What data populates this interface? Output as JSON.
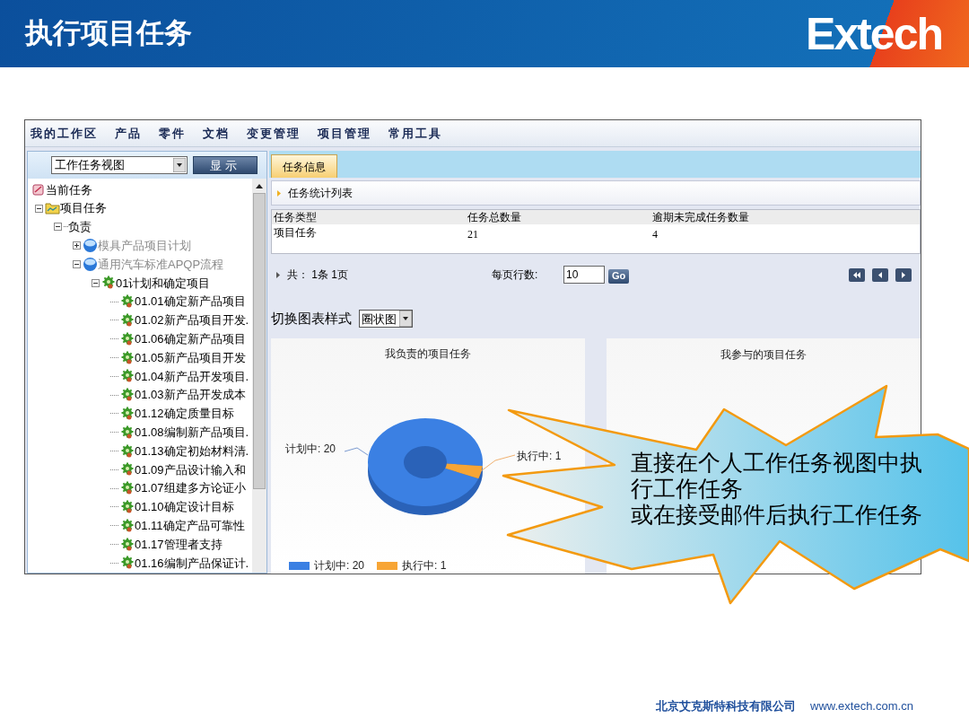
{
  "slide": {
    "title": "执行项目任务",
    "logo": "Extech"
  },
  "menu": [
    {
      "label": "我的工作区"
    },
    {
      "label": "产品"
    },
    {
      "label": "零件"
    },
    {
      "label": "文档"
    },
    {
      "label": "变更管理"
    },
    {
      "label": "项目管理"
    },
    {
      "label": "常用工具"
    }
  ],
  "view_select": {
    "value": "工作任务视图"
  },
  "show_button": "显示",
  "tree": [
    {
      "label": "当前任务",
      "kind": "root",
      "children": [
        {
          "label": "项目任务",
          "kind": "folder",
          "expanded": true,
          "children": [
            {
              "label": "负责",
              "kind": "group",
              "expanded": true,
              "children": [
                {
                  "label": "模具产品项目计划",
                  "kind": "project",
                  "expanded": false
                },
                {
                  "label": "通用汽车标准APQP流程",
                  "kind": "project",
                  "expanded": true,
                  "children": [
                    {
                      "label": "01计划和确定项目",
                      "kind": "task",
                      "expanded": true,
                      "children": [
                        {
                          "label": "01.01确定新产品项目",
                          "kind": "task"
                        },
                        {
                          "label": "01.02新产品项目开发.",
                          "kind": "task"
                        },
                        {
                          "label": "01.06确定新产品项目",
                          "kind": "task"
                        },
                        {
                          "label": "01.05新产品项目开发",
                          "kind": "task"
                        },
                        {
                          "label": "01.04新产品开发项目.",
                          "kind": "task"
                        },
                        {
                          "label": "01.03新产品开发成本",
                          "kind": "task"
                        },
                        {
                          "label": "01.12确定质量目标",
                          "kind": "task"
                        },
                        {
                          "label": "01.08编制新产品项目.",
                          "kind": "task"
                        },
                        {
                          "label": "01.13确定初始材料清.",
                          "kind": "task"
                        },
                        {
                          "label": "01.09产品设计输入和",
                          "kind": "task"
                        },
                        {
                          "label": "01.07组建多方论证小",
                          "kind": "task"
                        },
                        {
                          "label": "01.10确定设计目标",
                          "kind": "task"
                        },
                        {
                          "label": "01.11确定产品可靠性",
                          "kind": "task"
                        },
                        {
                          "label": "01.17管理者支持",
                          "kind": "task"
                        },
                        {
                          "label": "01.16编制产品保证计.",
                          "kind": "task"
                        }
                      ]
                    }
                  ]
                }
              ]
            }
          ]
        }
      ]
    }
  ],
  "tabs": [
    {
      "label": "任务信息",
      "selected": true
    }
  ],
  "section_title": "任务统计列表",
  "table": {
    "columns": [
      "任务类型",
      "任务总数量",
      "逾期未完成任务数量"
    ],
    "rows": [
      [
        "项目任务",
        "21",
        "4"
      ]
    ]
  },
  "pager": {
    "summary": "共： 1条 1页",
    "rows_label": "每页行数:",
    "rows_value": "10",
    "go": "Go"
  },
  "chart_style": {
    "label": "切换图表样式",
    "value": "圈状图"
  },
  "charts": [
    {
      "title": "我负责的项目任务",
      "legend": [
        "计划中: 20",
        "执行中: 1"
      ],
      "chart_data": {
        "type": "donut",
        "values": [
          20,
          1
        ],
        "colors": [
          "#3b80e3",
          "#f7a535"
        ],
        "value_labels": [
          "计划中: 20",
          "执行中: 1"
        ]
      }
    },
    {
      "title": "我参与的项目任务"
    }
  ],
  "callout": {
    "lines": [
      "直接在个人工作任务视图中执行工作任务",
      "或在接受邮件后执行工作任务"
    ]
  },
  "footer": {
    "company": "北京艾克斯特科技有限公司",
    "url": "www.extech.com.cn"
  }
}
